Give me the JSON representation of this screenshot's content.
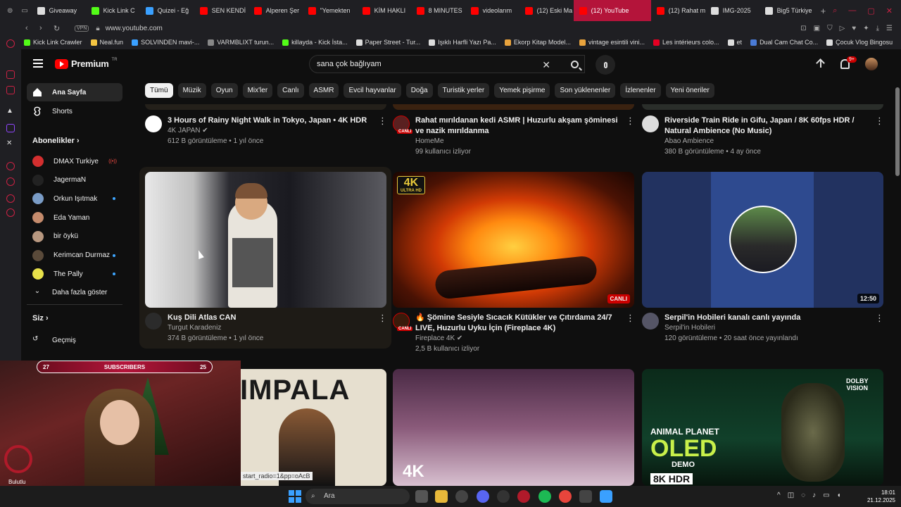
{
  "browser": {
    "tabs": [
      {
        "label": "Giveaway",
        "color": "#dddddd"
      },
      {
        "label": "Kick Link C",
        "color": "#53fc18"
      },
      {
        "label": "Quizei - Eğ",
        "color": "#3aa0ff"
      },
      {
        "label": "SEN KENDİ",
        "color": "#ff0000"
      },
      {
        "label": "Alperen Şer",
        "color": "#ff0000"
      },
      {
        "label": "\"Yemekten",
        "color": "#ff0000"
      },
      {
        "label": "KİM HAKLI",
        "color": "#ff0000"
      },
      {
        "label": "8 MINUTES",
        "color": "#ff0000"
      },
      {
        "label": "videolarım",
        "color": "#ff0000"
      },
      {
        "label": "(12) Eski Ma",
        "color": "#ff0000"
      },
      {
        "label": "(12) YouTube",
        "color": "#ff0000"
      },
      {
        "label": "(12) Rahat m",
        "color": "#ff0000"
      },
      {
        "label": "IMG-2025",
        "color": "#dddddd"
      },
      {
        "label": "Big5 Türkiye",
        "color": "#dddddd"
      }
    ],
    "active_tab_index": 10,
    "url": "www.youtube.com",
    "vpn_label": "VPN",
    "bookmarks": [
      {
        "label": "Kick Link Crawler",
        "color": "#53fc18"
      },
      {
        "label": "Neal.fun",
        "color": "#f4c542"
      },
      {
        "label": "SOLVINDEN mavi-...",
        "color": "#3aa0ff"
      },
      {
        "label": "VARMBLIXT turun...",
        "color": "#888888"
      },
      {
        "label": "killayda - Kick İsta...",
        "color": "#53fc18"
      },
      {
        "label": "Paper Street - Tur...",
        "color": "#dddddd"
      },
      {
        "label": "Işıklı Harfli Yazı Pa...",
        "color": "#dddddd"
      },
      {
        "label": "Ekorp Kitap Model...",
        "color": "#e8a33d"
      },
      {
        "label": "vintage esintili vini...",
        "color": "#e8a33d"
      },
      {
        "label": "Les intérieurs colo...",
        "color": "#e60023"
      },
      {
        "label": "et",
        "color": "#dddddd"
      },
      {
        "label": "Dual Cam Chat Co...",
        "color": "#4a7bd6"
      },
      {
        "label": "Çocuk Vlog Bingosu",
        "color": "#dddddd"
      }
    ]
  },
  "youtube": {
    "logo_text": "Premium",
    "logo_region": "TR",
    "search_value": "sana çok bağlıyam",
    "notification_count": "9+",
    "chips": [
      "Tümü",
      "Müzik",
      "Oyun",
      "Mix'ler",
      "Canlı",
      "ASMR",
      "Evcil hayvanlar",
      "Doğa",
      "Turistik yerler",
      "Yemek pişirme",
      "Son yüklenenler",
      "İzlenenler",
      "Yeni öneriler"
    ],
    "sidebar": {
      "home": "Ana Sayfa",
      "shorts": "Shorts",
      "subscriptions_header": "Abonelikler",
      "channels": [
        {
          "name": "DMAX Turkiye",
          "color": "#d32f2f",
          "indicator": "live"
        },
        {
          "name": "JagermaN",
          "color": "#222222",
          "indicator": ""
        },
        {
          "name": "Orkun Işıtmak",
          "color": "#7a9cc6",
          "indicator": "dot"
        },
        {
          "name": "Eda Yaman",
          "color": "#c58b6c",
          "indicator": ""
        },
        {
          "name": "bir öykü",
          "color": "#b89880",
          "indicator": ""
        },
        {
          "name": "Kerimcan Durmaz",
          "color": "#5a4a3a",
          "indicator": "dot"
        },
        {
          "name": "The Pally",
          "color": "#e8e14a",
          "indicator": "dot"
        }
      ],
      "show_more": "Daha fazla göster",
      "you_header": "Siz",
      "history": "Geçmiş"
    },
    "videos_row1": [
      {
        "title": "3 Hours of Rainy Night Walk in Tokyo, Japan • 4K HDR",
        "channel": "4K JAPAN ✔",
        "stats": "612 B görüntüleme • 1 yıl önce"
      },
      {
        "title": "Rahat mırıldanan kedi ASMR | Huzurlu akşam şöminesi ve nazik mırıldanma",
        "channel": "HomeMe",
        "stats": "99 kullanıcı izliyor",
        "live_badge": "CANLI"
      },
      {
        "title": "Riverside Train Ride in Gifu, Japan / 8K 60fps HDR / Natural Ambience (No Music)",
        "channel": "Abao Ambience",
        "stats": "380 B görüntüleme • 4 ay önce"
      }
    ],
    "videos_row2": [
      {
        "title": "Kuş Dili Atlas CAN",
        "channel": "Turgut Karadeniz",
        "stats": "374 B görüntüleme • 1 yıl önce"
      },
      {
        "title": "🔥 Şömine Sesiyle Sıcacık Kütükler ve Çıtırdama 24/7 LIVE, Huzurlu Uyku İçin (Fireplace 4K)",
        "channel": "Fireplace 4K ✔",
        "stats": "2,5 B kullanıcı izliyor",
        "badge": "CANLI",
        "thumb_label": "4K",
        "thumb_sublabel": "ULTRA HD",
        "avatar_badge": "CANLI"
      },
      {
        "title": "Serpil'in Hobileri kanalı canlı yayında",
        "channel": "Serpil'in Hobileri",
        "stats": "120 görüntüleme • 20 saat önce yayınlandı",
        "duration": "12:50"
      }
    ],
    "row3": {
      "impala_text": "IMPALA",
      "impala_caption": "start_radio=1&pp=oAcB",
      "snow_label": "4K",
      "oled_top": "ANIMAL PLANET",
      "oled_main": "OLED",
      "oled_sub": "DEMO",
      "oled_badge": "8K HDR",
      "dolby_top": "DOLBY",
      "dolby_bottom": "VISION"
    }
  },
  "overlay": {
    "sub_left": "27",
    "sub_label": "SUBSCRIBERS",
    "sub_right": "25"
  },
  "taskbar": {
    "search_placeholder": "Ara",
    "weather": "Bulutlu",
    "time": "18:01",
    "date": "21.12.2025"
  }
}
